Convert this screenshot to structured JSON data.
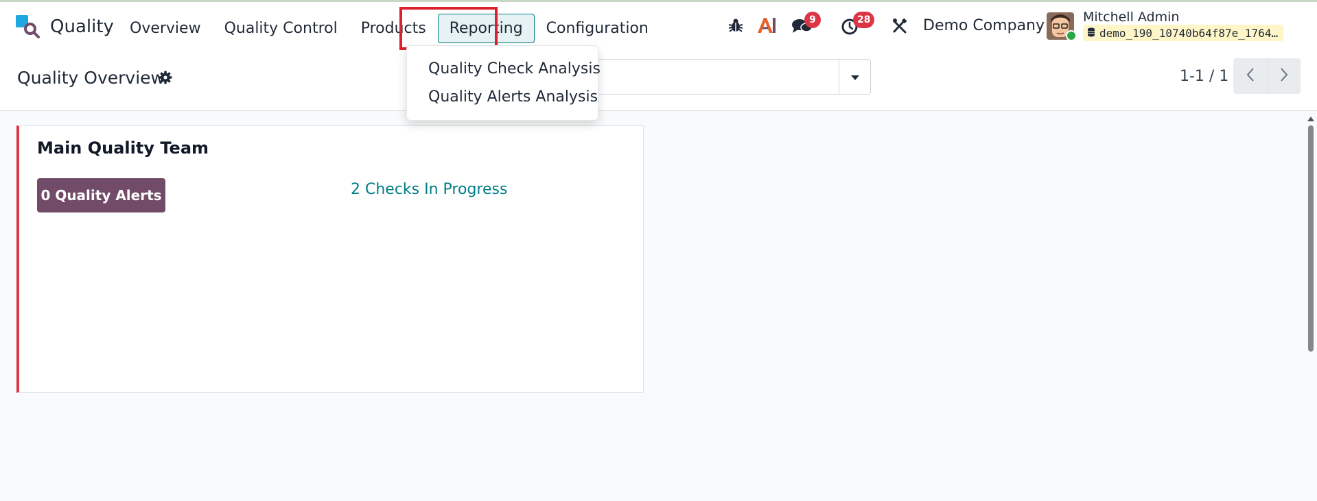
{
  "app": {
    "name": "Quality"
  },
  "nav": {
    "items": [
      {
        "label": "Overview"
      },
      {
        "label": "Quality Control"
      },
      {
        "label": "Products"
      },
      {
        "label": "Reporting"
      },
      {
        "label": "Configuration"
      }
    ],
    "active_index": 3
  },
  "reporting_menu": {
    "items": [
      {
        "label": "Quality Check Analysis"
      },
      {
        "label": "Quality Alerts Analysis"
      }
    ]
  },
  "systray": {
    "icons": [
      "bug-icon",
      "ai-icon",
      "chat-icon",
      "clock-icon",
      "tools-icon"
    ],
    "messages_count": "9",
    "activities_count": "28",
    "company": "Demo Company",
    "user_name": "Mitchell Admin",
    "database": "demo_190_10740b64f87e_1764…"
  },
  "control_panel": {
    "title": "Quality Overview",
    "search_placeholder": "",
    "pager": "1-1 / 1"
  },
  "team_card": {
    "name": "Main Quality Team",
    "alerts_button": "0 Quality Alerts",
    "checks_link": "2 Checks In Progress"
  },
  "colors": {
    "brand_purple": "#714b67",
    "accent_teal": "#017e84",
    "badge_red": "#dc3545",
    "highlight_red": "#e01f2d",
    "db_tag_yellow": "#fff6c7"
  }
}
